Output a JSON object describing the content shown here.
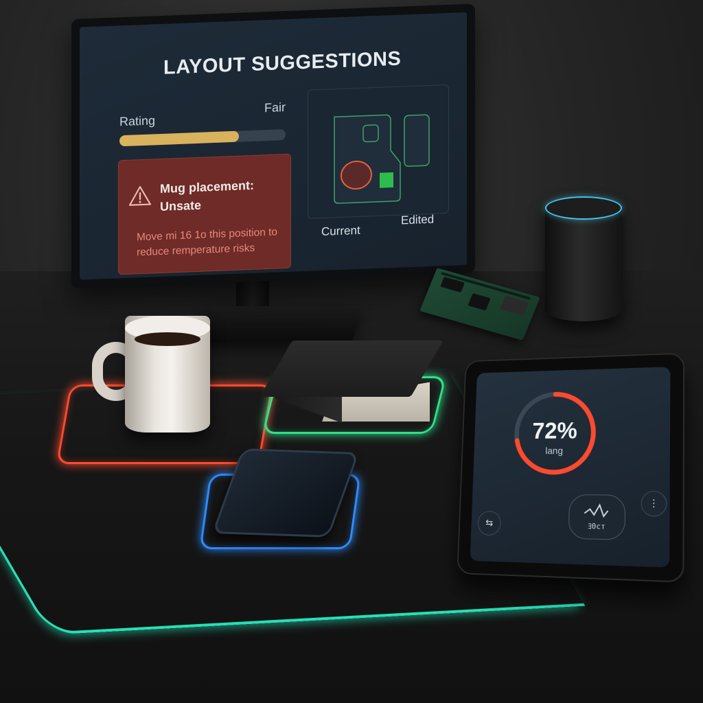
{
  "monitor": {
    "title": "LAYOUT SUGGESTIONS",
    "rating": {
      "label": "Rating",
      "value": "Fair",
      "level": 0.72
    },
    "alert": {
      "title": "Mug placement: Unsate",
      "body": "Move mi 16 1o this position to reduce remperature risks",
      "icon": "warning-icon",
      "color": "#6e2b27"
    },
    "layout": {
      "current_label": "Current",
      "edited_label": "Edited"
    }
  },
  "tablet": {
    "gauge_value": "72%",
    "gauge_label": "lang",
    "gauge_fraction": 0.72,
    "gauge_color": "#ff4a2e",
    "center_button_label": "ﾖ0cт",
    "left_button_icon": "swap-icon",
    "right_button_icon": "more-icon",
    "center_button_icon": "wave-icon"
  },
  "pads": {
    "mug_pad_color": "#ff4a2e",
    "book_pad_color": "#30e08a",
    "phone_pad_color": "#2f8cff",
    "mat_edge_color": "#27e0b5"
  },
  "speaker": {
    "ring_color": "#46c3e6"
  }
}
